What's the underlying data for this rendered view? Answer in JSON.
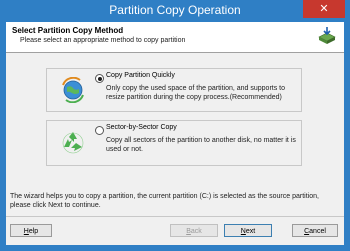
{
  "window": {
    "title": "Partition Copy Operation",
    "close_symbol": "✕"
  },
  "header": {
    "title": "Select Partition Copy Method",
    "subtitle": "Please select an appropriate method to copy partition",
    "icon": "disk-copy-icon"
  },
  "options": [
    {
      "label": "Copy Partition Quickly",
      "description": "Only copy the used space of the partition, and supports to resize partition during the copy process.(Recommended)",
      "selected": true,
      "icon": "globe-arrows-icon"
    },
    {
      "label": "Sector-by-Sector Copy",
      "description": "Copy all sectors of the partition to another disk, no matter it is used or not.",
      "selected": false,
      "icon": "recycle-icon"
    }
  ],
  "footer": {
    "text": "The wizard helps you to copy a partition, the current partition (C:) is selected as the source partition, please click Next to continue."
  },
  "buttons": {
    "help": {
      "accel": "H",
      "rest": "elp"
    },
    "back": {
      "accel": "B",
      "rest": "ack"
    },
    "next": {
      "accel": "N",
      "rest": "ext"
    },
    "cancel": {
      "accel": "C",
      "rest": "ancel"
    }
  },
  "colors": {
    "titlebar": "#2f7fc5",
    "close_button": "#c7382e",
    "client": "#f0f0f0"
  }
}
